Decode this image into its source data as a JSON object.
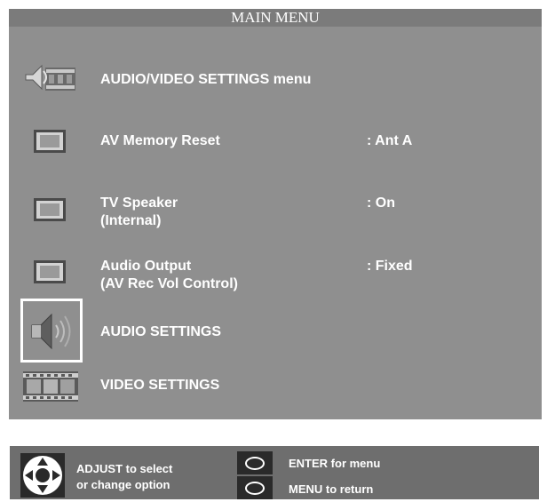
{
  "title": "MAIN MENU",
  "items": [
    {
      "icon": "audio-video-settings-icon",
      "label": "AUDIO/VIDEO SETTINGS menu",
      "value": ""
    },
    {
      "icon": "tv-icon",
      "label": "AV Memory Reset",
      "value": ": Ant A"
    },
    {
      "icon": "tv-icon",
      "label": "TV Speaker",
      "label2": "(Internal)",
      "value": ": On"
    },
    {
      "icon": "tv-icon",
      "label": "Audio Output",
      "label2": "(AV Rec Vol Control)",
      "value": ": Fixed"
    },
    {
      "icon": "speaker-icon",
      "label": "AUDIO SETTINGS",
      "value": "",
      "selected": true
    },
    {
      "icon": "film-strip-icon",
      "label": "VIDEO SETTINGS",
      "value": ""
    }
  ],
  "footer": {
    "adjust_line1": "ADJUST to select",
    "adjust_line2": "or change option",
    "enter_label": "ENTER for menu",
    "menu_label": "MENU to return"
  },
  "colors": {
    "panel": "#8f8f8f",
    "title_bar": "#7b7b7b",
    "bottom_bar": "#6e6e6e",
    "text": "#ffffff"
  }
}
